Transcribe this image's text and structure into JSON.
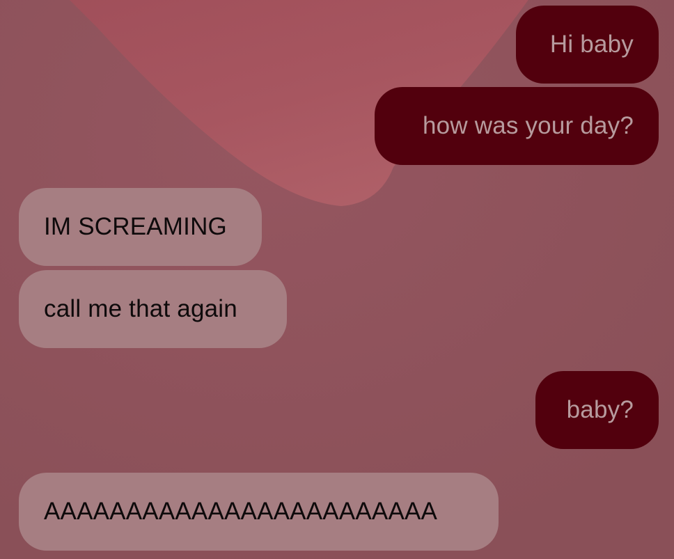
{
  "background": {
    "base_color": "#8e525a",
    "heart_color": "#a85560"
  },
  "colors": {
    "sent_bubble": "#52000d",
    "sent_text": "#b79b9e",
    "received_bubble": "#a67e82",
    "received_text": "#0e0a0b"
  },
  "messages": [
    {
      "direction": "sent",
      "text": "Hi baby"
    },
    {
      "direction": "sent",
      "text": "how was your day?"
    },
    {
      "direction": "received",
      "text": "IM SCREAMING"
    },
    {
      "direction": "received",
      "text": "call me that again"
    },
    {
      "direction": "sent",
      "text": "baby?"
    },
    {
      "direction": "received",
      "text": "AAAAAAAAAAAAAAAAAAAAAAAA"
    }
  ]
}
